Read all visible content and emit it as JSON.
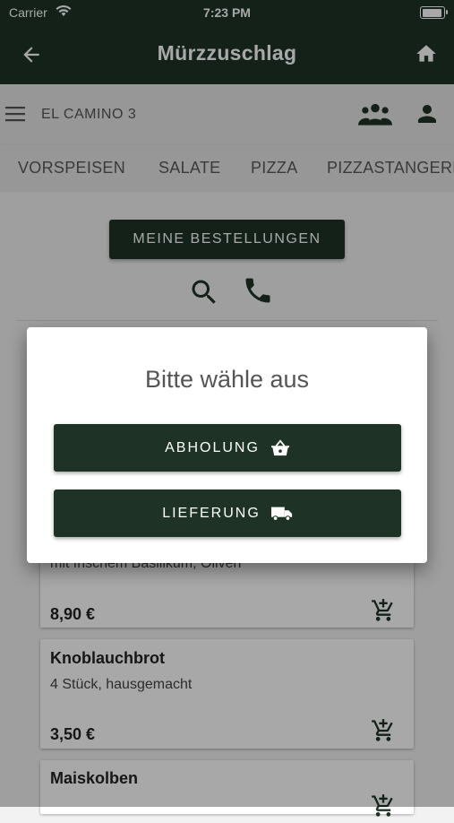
{
  "status_bar": {
    "carrier": "Carrier",
    "time": "7:23 PM"
  },
  "app_bar": {
    "title": "Mürzzuschlag"
  },
  "sub_bar": {
    "address": "EL CAMINO 3"
  },
  "tabs": [
    {
      "label": "VORSPEISEN"
    },
    {
      "label": "SALATE"
    },
    {
      "label": "PIZZA"
    },
    {
      "label": "PIZZASTANGERL"
    }
  ],
  "orders_button": {
    "label": "MEINE BESTELLUNGEN"
  },
  "products": [
    {
      "name": "",
      "description": "mit frischem Basilikum, Oliven",
      "price": "8,90 €"
    },
    {
      "name": "Knoblauchbrot",
      "description": "4 Stück, hausgemacht",
      "price": "3,50 €"
    },
    {
      "name": "Maiskolben",
      "description": "",
      "price": ""
    }
  ],
  "dialog": {
    "title": "Bitte wähle aus",
    "pickup_label": "ABHOLUNG",
    "delivery_label": "LIEFERUNG"
  },
  "colors": {
    "primary": "#1e3326",
    "overlay": "rgba(0,0,0,0.34)"
  },
  "icons": [
    "wifi-icon",
    "battery-icon",
    "back-arrow-icon",
    "home-icon",
    "menu-icon",
    "group-icon",
    "person-icon",
    "search-icon",
    "phone-icon",
    "add-cart-icon",
    "basket-icon",
    "truck-icon"
  ]
}
